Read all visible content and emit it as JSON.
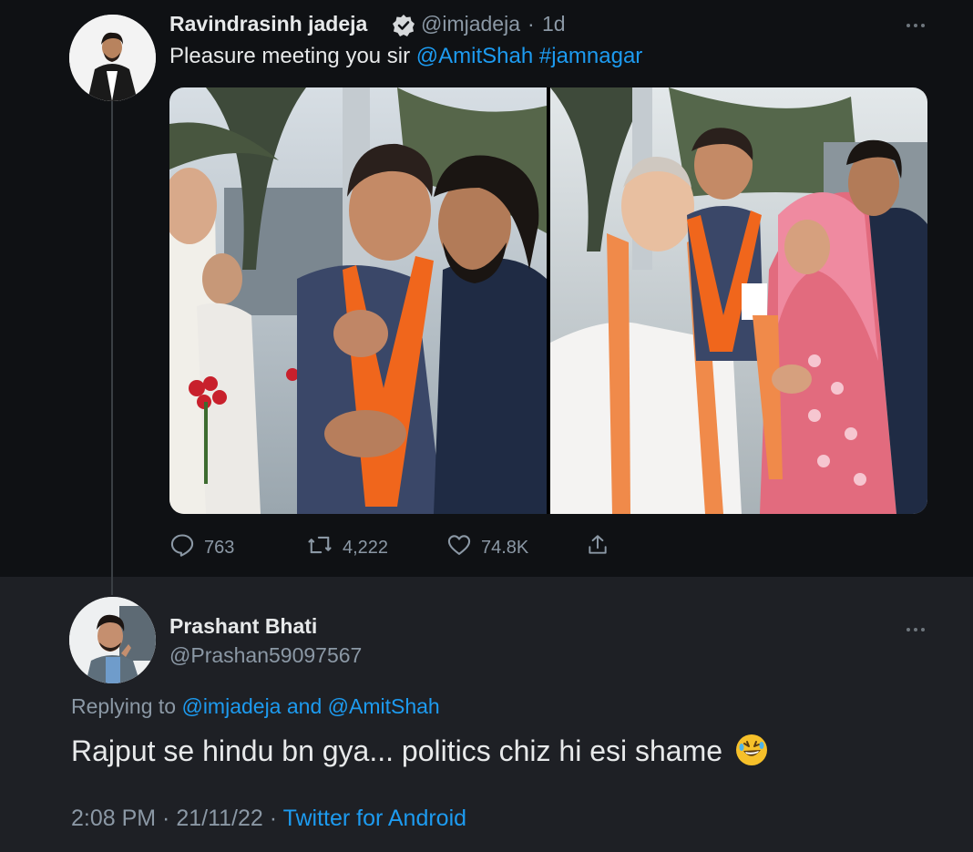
{
  "tweet": {
    "author_name": "Ravindrasinh jadeja",
    "handle": "@imjadeja",
    "separator": "·",
    "time": "1d",
    "text": "Pleasure meeting you sir ",
    "mention": "@AmitShah",
    "hashtag": "#jamnagar",
    "more_icon": "more-horizontal-icon",
    "verified_icon": "verified-badge-icon",
    "photo_count": 2,
    "actions": {
      "replies": "763",
      "retweets": "4,222",
      "likes": "74.8K"
    },
    "colors": {
      "link": "#1d9bf0",
      "muted": "#8b98a5",
      "text": "#e7e9ea",
      "background": "#0f1114"
    }
  },
  "reply": {
    "author_name": "Prashant Bhati",
    "handle": "@Prashan59097567",
    "replying_prefix": "Replying to ",
    "replying_user1": "@imjadeja",
    "replying_and": " and ",
    "replying_user2": "@AmitShah",
    "text": "Rajput se hindu bn gya... politics chiz hi esi shame",
    "emoji": "rolling-on-floor-laughing-emoji",
    "time": "2:08 PM",
    "date": "21/11/22",
    "source": "Twitter for Android",
    "sep": " · ",
    "background": "#1e2025"
  }
}
